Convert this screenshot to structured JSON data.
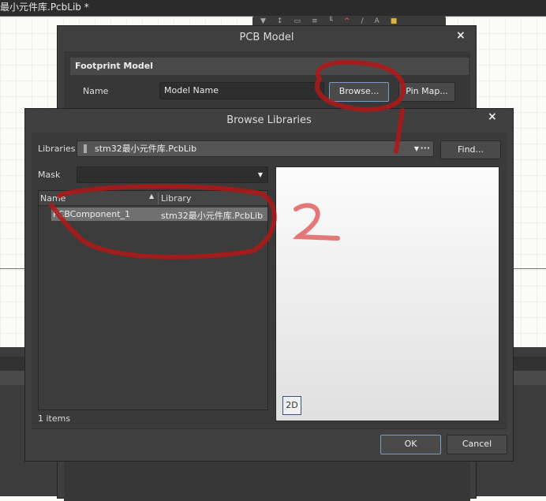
{
  "app": {
    "document_tab_title": "最小元件库.PcbLib *"
  },
  "pcb_model_dialog": {
    "title": "PCB Model",
    "section_title": "Footprint Model",
    "name_label": "Name",
    "name_value": "Model Name",
    "browse_button": "Browse...",
    "pin_map_button": "Pin Map..."
  },
  "browse_libraries_dialog": {
    "title": "Browse Libraries",
    "libraries_label": "Libraries",
    "libraries_value": "stm32最小元件库.PcbLib",
    "more_button": "•••",
    "find_button": "Find...",
    "mask_label": "Mask",
    "mask_value": "",
    "columns": [
      "Name",
      "Library"
    ],
    "rows": [
      {
        "name": "PCBComponent_1",
        "library": "stm32最小元件库.PcbLib",
        "selected": true
      }
    ],
    "item_count": "1 items",
    "view_mode_button": "2D",
    "ok_button": "OK",
    "cancel_button": "Cancel"
  },
  "annotations": {
    "color": "#b01818",
    "labels": [
      "1",
      "2"
    ]
  }
}
